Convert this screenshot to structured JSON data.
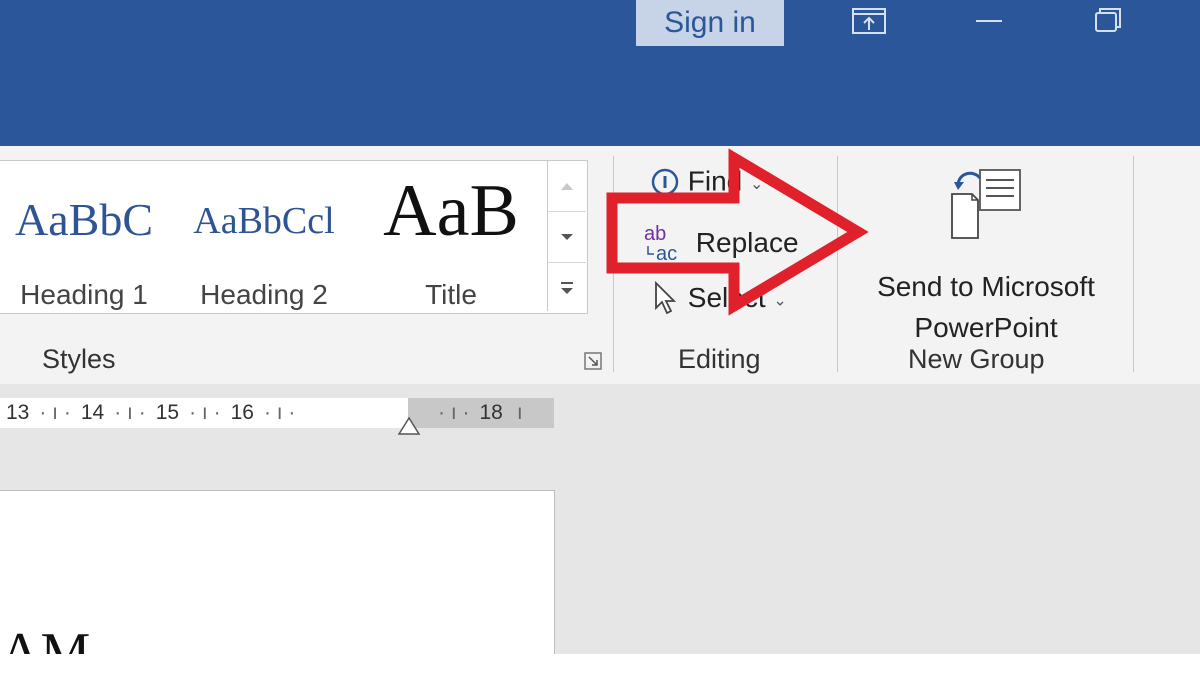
{
  "titlebar": {
    "sign_in": "Sign in",
    "color": "#2b579a"
  },
  "styles_group": {
    "items": [
      {
        "preview": "AaBbC",
        "name": "Heading 1"
      },
      {
        "preview": "AaBbCcl",
        "name": "Heading 2"
      },
      {
        "preview": "AaB",
        "name": "Title"
      }
    ],
    "label": "Styles"
  },
  "editing_group": {
    "find": "Find",
    "replace": "Replace",
    "select": "Select",
    "label": "Editing"
  },
  "new_group": {
    "button_line1": "Send to Microsoft",
    "button_line2": "PowerPoint",
    "label": "New Group"
  },
  "ruler": {
    "marks": [
      "13",
      "14",
      "15",
      "16",
      "18"
    ]
  },
  "page": {
    "partial_text": "AM"
  },
  "annotation": {
    "arrow_color": "#e0202a",
    "icon": "right-arrow-icon"
  }
}
